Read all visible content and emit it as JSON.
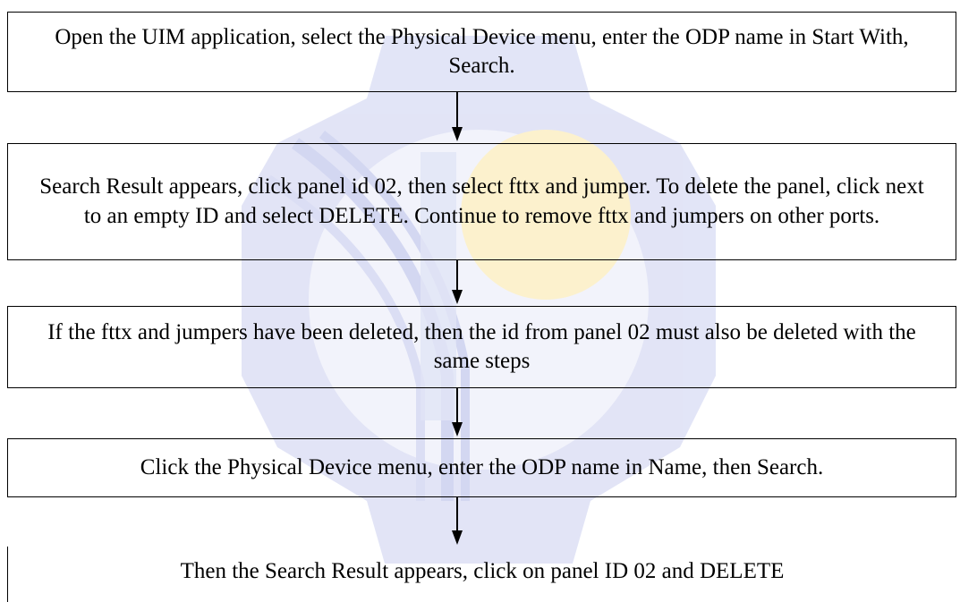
{
  "steps": [
    {
      "text": "Open the UIM application, select the Physical Device menu, enter the ODP name in Start With, Search."
    },
    {
      "text": "Search Result appears, click panel id 02, then select fttx and jumper. To delete the panel, click next to an empty ID and select DELETE. Continue to remove fttx and jumpers on other ports."
    },
    {
      "text": "If the fttx and jumpers have been deleted, then the id from panel 02 must also be deleted with the same steps"
    },
    {
      "text": "Click the Physical Device menu, enter the ODP name in Name, then Search."
    },
    {
      "text": "Then the Search Result appears, click on panel ID 02 and DELETE"
    }
  ],
  "colors": {
    "border": "#000000",
    "arrow": "#000000",
    "watermark_blue": "#c8cdee",
    "watermark_yellow": "#fbefc4"
  },
  "icons": {
    "watermark": "university-gear-logo-watermark",
    "connector": "down-arrow-icon"
  }
}
